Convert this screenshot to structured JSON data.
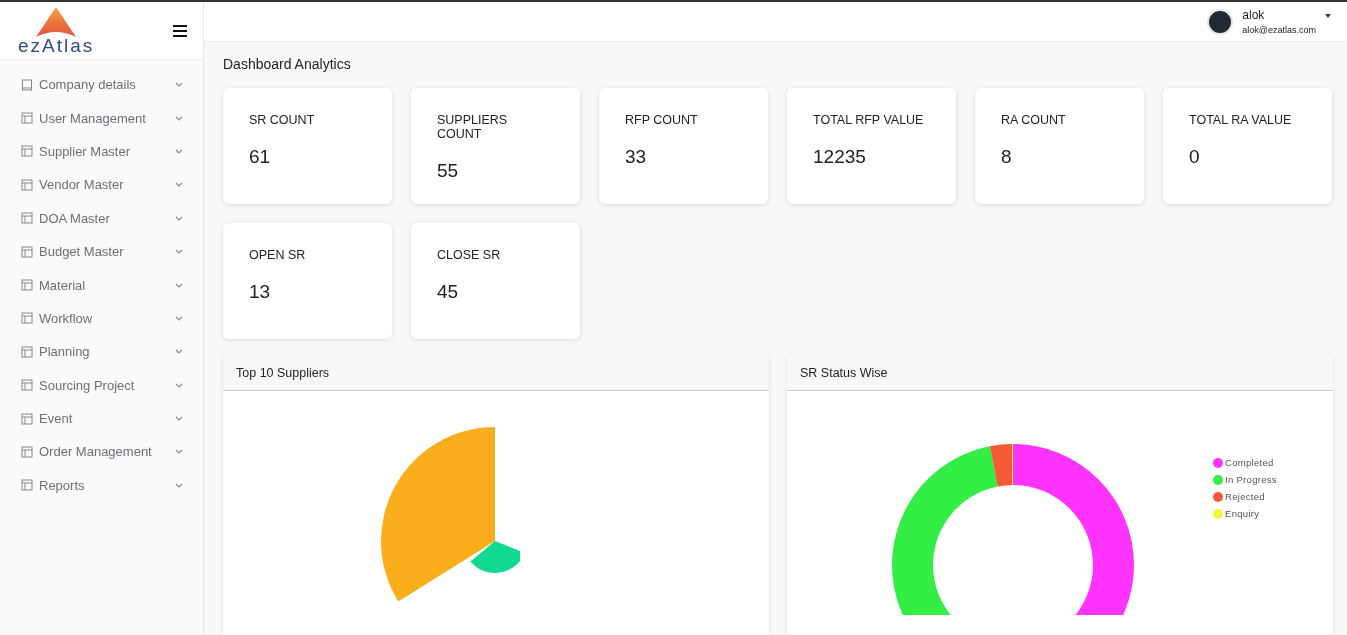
{
  "brand": {
    "name": "ezAtlas"
  },
  "sidebar": {
    "items": [
      {
        "label": "Company details",
        "kind": "book"
      },
      {
        "label": "User Management",
        "kind": "table"
      },
      {
        "label": "Supplier Master",
        "kind": "table"
      },
      {
        "label": "Vendor Master",
        "kind": "table"
      },
      {
        "label": "DOA Master",
        "kind": "table"
      },
      {
        "label": "Budget Master",
        "kind": "table"
      },
      {
        "label": "Material",
        "kind": "table"
      },
      {
        "label": "Workflow",
        "kind": "table"
      },
      {
        "label": "Planning",
        "kind": "table"
      },
      {
        "label": "Sourcing Project",
        "kind": "table"
      },
      {
        "label": "Event",
        "kind": "table"
      },
      {
        "label": "Order Management",
        "kind": "table"
      },
      {
        "label": "Reports",
        "kind": "table"
      }
    ]
  },
  "user": {
    "name": "alok",
    "email": "alok@ezatlas.com"
  },
  "page_title": "Dashboard Analytics",
  "stats": [
    {
      "label": "SR COUNT",
      "value": "61"
    },
    {
      "label": "SUPPLIERS COUNT",
      "value": "55"
    },
    {
      "label": "RFP COUNT",
      "value": "33"
    },
    {
      "label": "TOTAL RFP VALUE",
      "value": "12235"
    },
    {
      "label": "RA COUNT",
      "value": "8"
    },
    {
      "label": "TOTAL RA VALUE",
      "value": "0"
    },
    {
      "label": "OPEN SR",
      "value": "13"
    },
    {
      "label": "CLOSE SR",
      "value": "45"
    }
  ],
  "panels": [
    {
      "title": "Top 10 Suppliers",
      "kind": "pie"
    },
    {
      "title": "SR Status Wise",
      "kind": "donut",
      "legend": [
        {
          "label": "Completed",
          "color": "#ff33ff"
        },
        {
          "label": "In Progress",
          "color": "#33ee44"
        },
        {
          "label": "Rejected",
          "color": "#f45b35"
        },
        {
          "label": "Enquiry",
          "color": "#f5f53a"
        }
      ]
    }
  ]
}
